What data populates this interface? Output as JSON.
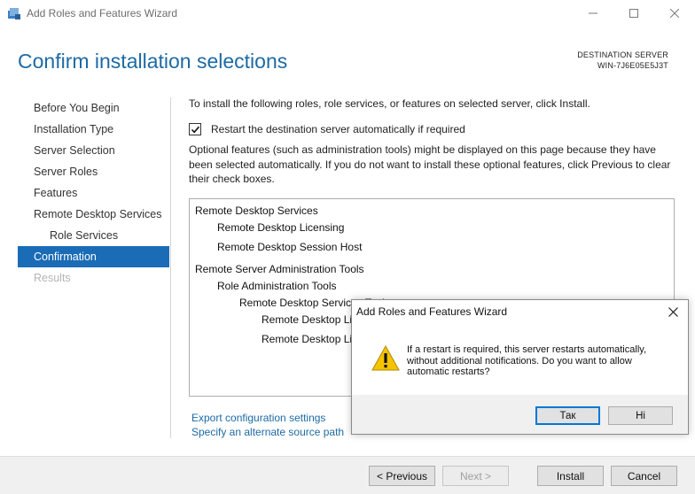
{
  "window": {
    "title": "Add Roles and Features Wizard"
  },
  "header": {
    "title": "Confirm installation selections",
    "destination_label": "DESTINATION SERVER",
    "destination_name": "WIN-7J6E05E5J3T"
  },
  "nav": {
    "items": [
      {
        "label": "Before You Begin",
        "state": "normal"
      },
      {
        "label": "Installation Type",
        "state": "normal"
      },
      {
        "label": "Server Selection",
        "state": "normal"
      },
      {
        "label": "Server Roles",
        "state": "normal"
      },
      {
        "label": "Features",
        "state": "normal"
      },
      {
        "label": "Remote Desktop Services",
        "state": "normal"
      },
      {
        "label": "Role Services",
        "state": "sub"
      },
      {
        "label": "Confirmation",
        "state": "active"
      },
      {
        "label": "Results",
        "state": "disabled"
      }
    ]
  },
  "main": {
    "intro": "To install the following roles, role services, or features on selected server, click Install.",
    "restart_checkbox": {
      "label": "Restart the destination server automatically if required",
      "checked": true
    },
    "optional_text": "Optional features (such as administration tools) might be displayed on this page because they have been selected automatically. If you do not want to install these optional features, click Previous to clear their check boxes.",
    "list": [
      "Remote Desktop Services",
      "Remote Desktop Licensing",
      "Remote Desktop Session Host",
      "Remote Server Administration Tools",
      "Role Administration Tools",
      "Remote Desktop Services Tools",
      "Remote Desktop Licensing Diagnoser Tools",
      "Remote Desktop Licensing Tools"
    ],
    "export_link": "Export configuration settings",
    "source_link": "Specify an alternate source path"
  },
  "footer": {
    "previous": "< Previous",
    "next": "Next >",
    "install": "Install",
    "cancel": "Cancel"
  },
  "dialog": {
    "title": "Add Roles and Features Wizard",
    "message": "If a restart is required, this server restarts automatically, without additional notifications. Do you want to allow automatic restarts?",
    "yes": "Так",
    "no": "Ні"
  },
  "colors": {
    "accent": "#1a6cb6",
    "title": "#1d6aa5",
    "warning": "#f5c400"
  }
}
